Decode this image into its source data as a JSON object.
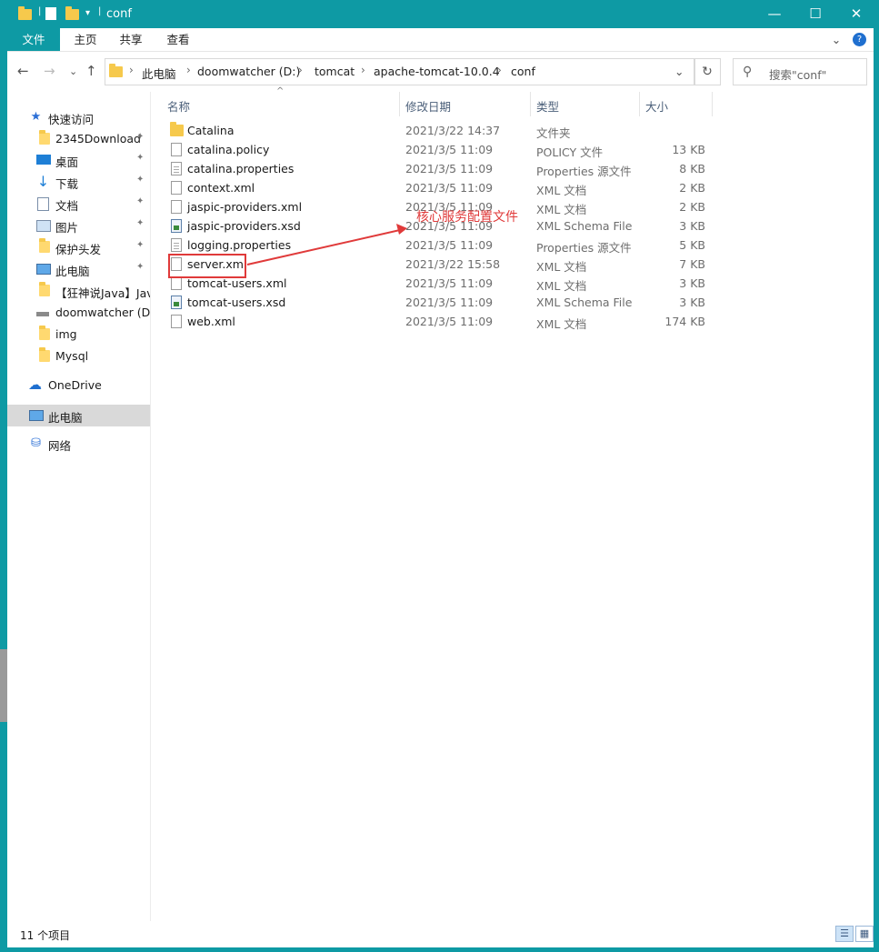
{
  "window": {
    "title": "conf",
    "controls": {
      "minimize": "—",
      "maximize": "☐",
      "close": "✕"
    }
  },
  "ribbon": {
    "tabs": [
      "文件",
      "主页",
      "共享",
      "查看"
    ],
    "collapse_icon": "⌄",
    "help_icon": "?"
  },
  "address": {
    "breadcrumbs": [
      "此电脑",
      "doomwatcher (D:)",
      "tomcat",
      "apache-tomcat-10.0.4",
      "conf"
    ],
    "dropdown_icon": "⌄",
    "refresh_icon": "↻",
    "search_placeholder": "搜索\"conf\""
  },
  "nav_buttons": {
    "back": "←",
    "forward": "→",
    "recent": "⌄",
    "up": "↑"
  },
  "sidebar": {
    "items": [
      {
        "label": "快速访问",
        "icon": "star-icon",
        "pinned": false
      },
      {
        "label": "2345Download",
        "icon": "folder-icon",
        "pinned": true
      },
      {
        "label": "桌面",
        "icon": "desktop-icon",
        "pinned": true
      },
      {
        "label": "下载",
        "icon": "download-icon",
        "pinned": true
      },
      {
        "label": "文档",
        "icon": "document-icon",
        "pinned": true
      },
      {
        "label": "图片",
        "icon": "picture-icon",
        "pinned": true
      },
      {
        "label": "保护头发",
        "icon": "folder-icon",
        "pinned": true
      },
      {
        "label": "此电脑",
        "icon": "computer-icon",
        "pinned": true
      },
      {
        "label": "【狂神说Java】Jav",
        "icon": "folder-icon",
        "pinned": false
      },
      {
        "label": "doomwatcher (D:)",
        "icon": "drive-icon",
        "pinned": false
      },
      {
        "label": "img",
        "icon": "folder-icon",
        "pinned": false
      },
      {
        "label": "Mysql",
        "icon": "folder-icon",
        "pinned": false
      },
      {
        "label": "OneDrive",
        "icon": "cloud-icon",
        "pinned": false
      },
      {
        "label": "此电脑",
        "icon": "computer-icon",
        "pinned": false,
        "selected": true
      },
      {
        "label": "网络",
        "icon": "network-icon",
        "pinned": false
      }
    ],
    "pin_glyph": "📌"
  },
  "columns": {
    "name": "名称",
    "date": "修改日期",
    "type": "类型",
    "size": "大小"
  },
  "files": [
    {
      "name": "Catalina",
      "date": "2021/3/22 14:37",
      "type": "文件夹",
      "size": "",
      "icon": "folder"
    },
    {
      "name": "catalina.policy",
      "date": "2021/3/5 11:09",
      "type": "POLICY 文件",
      "size": "13 KB",
      "icon": "file"
    },
    {
      "name": "catalina.properties",
      "date": "2021/3/5 11:09",
      "type": "Properties 源文件",
      "size": "8 KB",
      "icon": "prop"
    },
    {
      "name": "context.xml",
      "date": "2021/3/5 11:09",
      "type": "XML 文档",
      "size": "2 KB",
      "icon": "file"
    },
    {
      "name": "jaspic-providers.xml",
      "date": "2021/3/5 11:09",
      "type": "XML 文档",
      "size": "2 KB",
      "icon": "file"
    },
    {
      "name": "jaspic-providers.xsd",
      "date": "2021/3/5 11:09",
      "type": "XML Schema File",
      "size": "3 KB",
      "icon": "xsd"
    },
    {
      "name": "logging.properties",
      "date": "2021/3/5 11:09",
      "type": "Properties 源文件",
      "size": "5 KB",
      "icon": "prop"
    },
    {
      "name": "server.xml",
      "date": "2021/3/22 15:58",
      "type": "XML 文档",
      "size": "7 KB",
      "icon": "file"
    },
    {
      "name": "tomcat-users.xml",
      "date": "2021/3/5 11:09",
      "type": "XML 文档",
      "size": "3 KB",
      "icon": "file"
    },
    {
      "name": "tomcat-users.xsd",
      "date": "2021/3/5 11:09",
      "type": "XML Schema File",
      "size": "3 KB",
      "icon": "xsd"
    },
    {
      "name": "web.xml",
      "date": "2021/3/5 11:09",
      "type": "XML 文档",
      "size": "174 KB",
      "icon": "file"
    }
  ],
  "annotation": {
    "text": "核心服务配置文件",
    "color": "#e03a3a"
  },
  "status_bar": {
    "count": "11 个项目"
  },
  "colors": {
    "accent": "#0e9aa4",
    "folder": "#f6c94c",
    "annotation": "#e03a3a"
  }
}
